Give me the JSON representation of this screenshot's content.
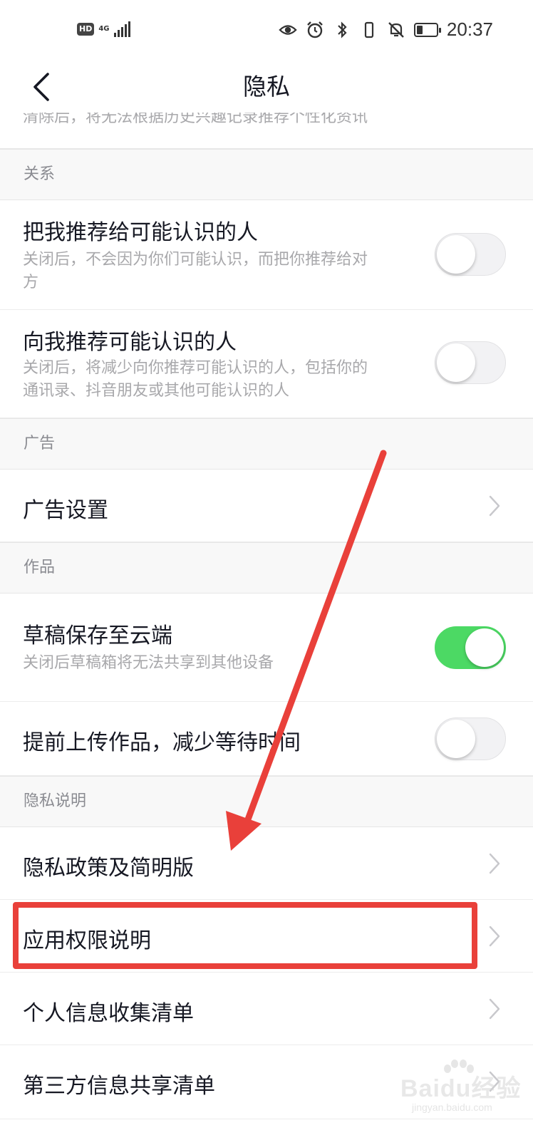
{
  "status_bar": {
    "hd_label": "HD",
    "network_label": "4G",
    "time": "20:37",
    "battery_level": 0.3,
    "icons": [
      "eye-icon",
      "alarm-icon",
      "bluetooth-icon",
      "vibrate-icon",
      "mute-icon",
      "battery-icon"
    ]
  },
  "nav": {
    "title": "隐私",
    "back_icon": "chevron-left-icon"
  },
  "truncated_text": "清除后，将无法根据历史兴趣记录推荐个性化资讯",
  "sections": {
    "relations": {
      "header": "关系",
      "items": [
        {
          "title": "把我推荐给可能认识的人",
          "desc_line1": "关闭后，不会因为你们可能认识，而把你推荐给对",
          "desc_line2": "方",
          "toggle_on": false
        },
        {
          "title": "向我推荐可能认识的人",
          "desc_line1": "关闭后，将减少向你推荐可能认识的人，包括你的",
          "desc_line2": "通讯录、抖音朋友或其他可能认识的人",
          "toggle_on": false
        }
      ]
    },
    "ads": {
      "header": "广告",
      "items": [
        {
          "title": "广告设置"
        }
      ]
    },
    "works": {
      "header": "作品",
      "items": [
        {
          "title": "草稿保存至云端",
          "desc": "关闭后草稿箱将无法共享到其他设备",
          "toggle_on": true
        },
        {
          "title": "提前上传作品，减少等待时间",
          "toggle_on": false
        }
      ]
    },
    "privacy_info": {
      "header": "隐私说明",
      "items": [
        {
          "title": "隐私政策及简明版"
        },
        {
          "title": "应用权限说明"
        },
        {
          "title": "个人信息收集清单"
        },
        {
          "title": "第三方信息共享清单"
        }
      ]
    }
  },
  "annotation_color": "#e9403a",
  "toggle_on_color": "#4cd964",
  "watermark": {
    "main": "Baidu经验",
    "sub": "jingyan.baidu.com"
  }
}
